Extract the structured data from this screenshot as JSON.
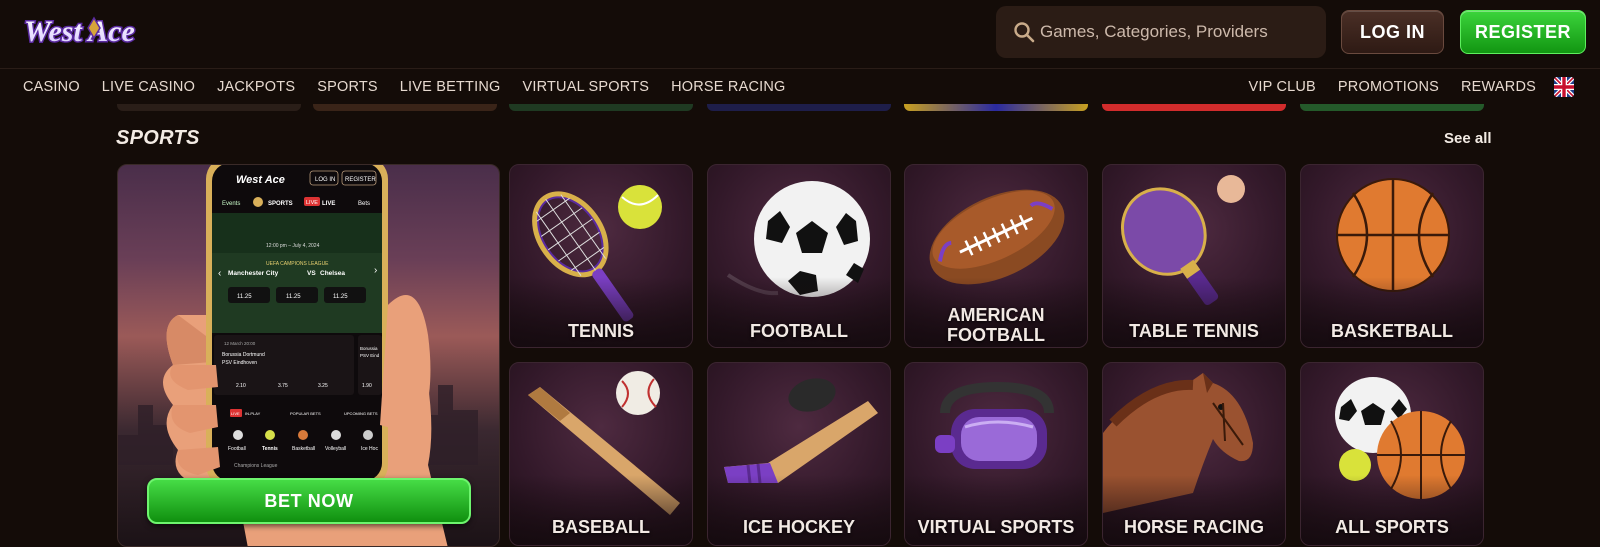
{
  "header": {
    "logo_text": "West Ace",
    "search_placeholder": "Games, Categories, Providers",
    "login_label": "LOG IN",
    "register_label": "REGISTER"
  },
  "nav": {
    "left": [
      "CASINO",
      "LIVE CASINO",
      "JACKPOTS",
      "SPORTS",
      "LIVE BETTING",
      "VIRTUAL SPORTS",
      "HORSE RACING"
    ],
    "right": [
      "VIP CLUB",
      "PROMOTIONS",
      "REWARDS"
    ],
    "language_flag": "uk-flag-icon"
  },
  "section": {
    "title": "SPORTS",
    "see_all": "See all"
  },
  "promo": {
    "cta_label": "BET NOW",
    "phone": {
      "logo": "West Ace",
      "login": "LOG IN",
      "register": "REGISTER",
      "tab_events": "Events",
      "tab_sports": "SPORTS",
      "tab_live": "LIVE",
      "tab_bets": "Bets",
      "match_time": "12:00 pm – July 4, 2024",
      "league": "UEFA CAMPIONS LEAGUE",
      "home": "Manchester City",
      "vs": "VS",
      "away": "Chelsea",
      "odds": [
        "11.25",
        "11.25",
        "11.25"
      ],
      "match2_time": "12 March 20:00",
      "match2_home": "Borussia Dortmund",
      "match2_away": "PSV Eindhoven",
      "match3_home": "Borussia",
      "match3_away": "PSV Eind",
      "odds2": [
        "2.10",
        "3.75",
        "3.25",
        "1.90"
      ],
      "live_label": "LIVE",
      "inplay": "IN-PLAY",
      "popular": "POPULAR BETS",
      "upcoming": "UPCOMING BETS",
      "sports": [
        "Football",
        "Tennis",
        "Basketball",
        "Volleyball",
        "Ice Hoc"
      ],
      "bottom_text": "Champions League"
    }
  },
  "tiles": [
    {
      "label": "TENNIS",
      "icon": "tennis-icon"
    },
    {
      "label": "FOOTBALL",
      "icon": "football-icon"
    },
    {
      "label": "AMERICAN FOOTBALL",
      "icon": "american-football-icon"
    },
    {
      "label": "TABLE TENNIS",
      "icon": "table-tennis-icon"
    },
    {
      "label": "BASKETBALL",
      "icon": "basketball-icon"
    },
    {
      "label": "BASEBALL",
      "icon": "baseball-icon"
    },
    {
      "label": "ICE HOCKEY",
      "icon": "ice-hockey-icon"
    },
    {
      "label": "VIRTUAL SPORTS",
      "icon": "vr-headset-icon"
    },
    {
      "label": "HORSE RACING",
      "icon": "horse-icon"
    },
    {
      "label": "ALL SPORTS",
      "icon": "all-sports-icon"
    }
  ],
  "colors": {
    "background": "#140c08",
    "register_green": "#1fb21f",
    "login_brown": "#3a241c",
    "accent_purple": "#7b3fc4"
  }
}
